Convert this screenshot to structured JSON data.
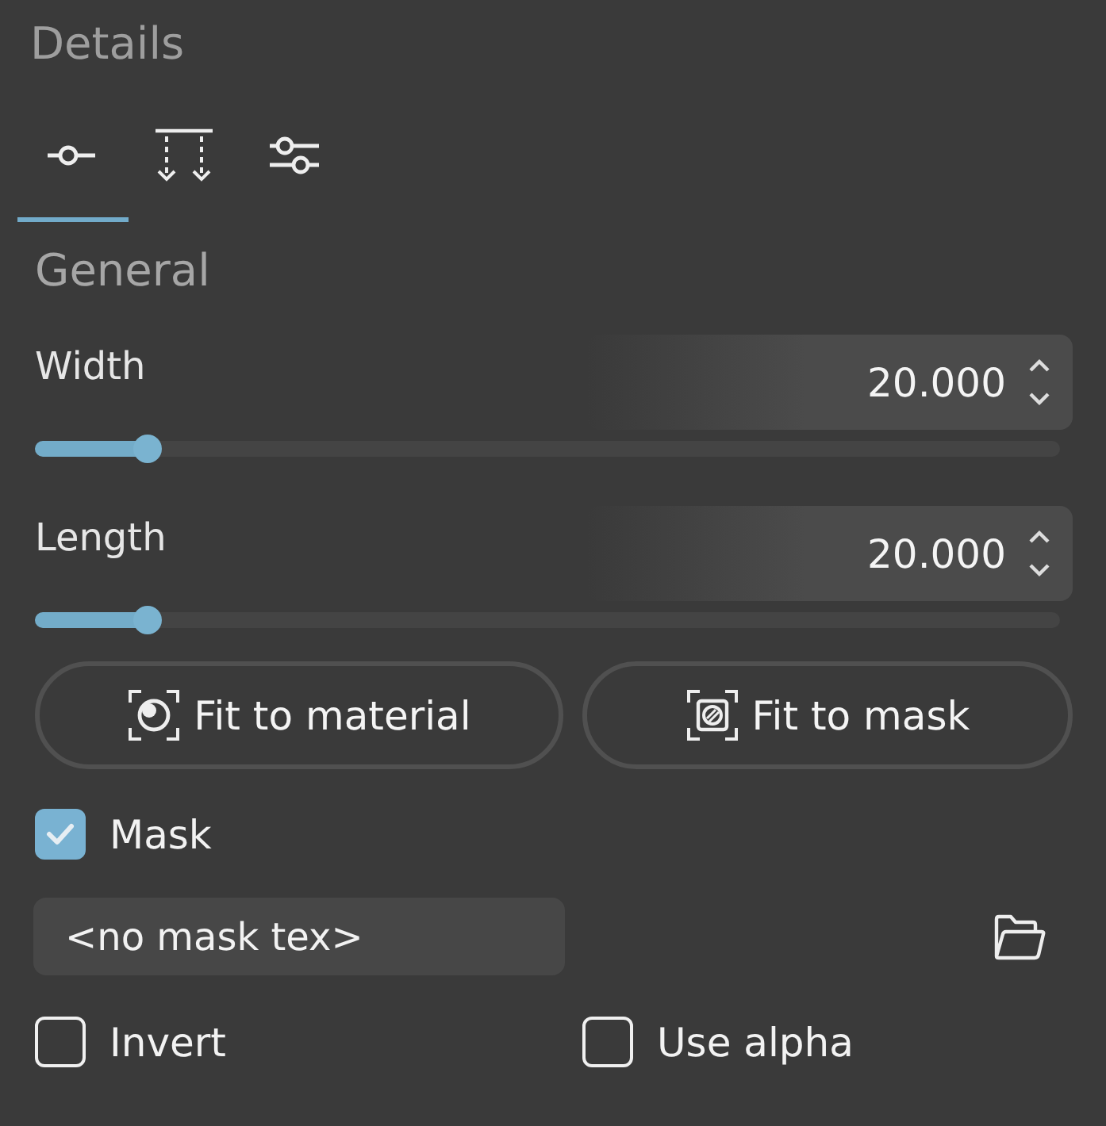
{
  "panel": {
    "title": "Details"
  },
  "tabs": [
    {
      "kind": "single",
      "selected": true
    },
    {
      "kind": "drop",
      "selected": false
    },
    {
      "kind": "sliders",
      "selected": false
    }
  ],
  "section": {
    "title": "General"
  },
  "params": [
    {
      "label": "Width",
      "value": "20.000",
      "level": 0.11
    },
    {
      "label": "Length",
      "value": "20.000",
      "level": 0.11
    }
  ],
  "buttons": [
    {
      "kind": "material",
      "label": "Fit to material"
    },
    {
      "kind": "mask",
      "label": "Fit to mask"
    }
  ],
  "mask": {
    "label": "Mask",
    "checked": true
  },
  "mask_texture": {
    "value": "<no mask tex>"
  },
  "options": [
    {
      "label": "Invert",
      "checked": false
    },
    {
      "label": "Use alpha",
      "checked": false
    }
  ]
}
